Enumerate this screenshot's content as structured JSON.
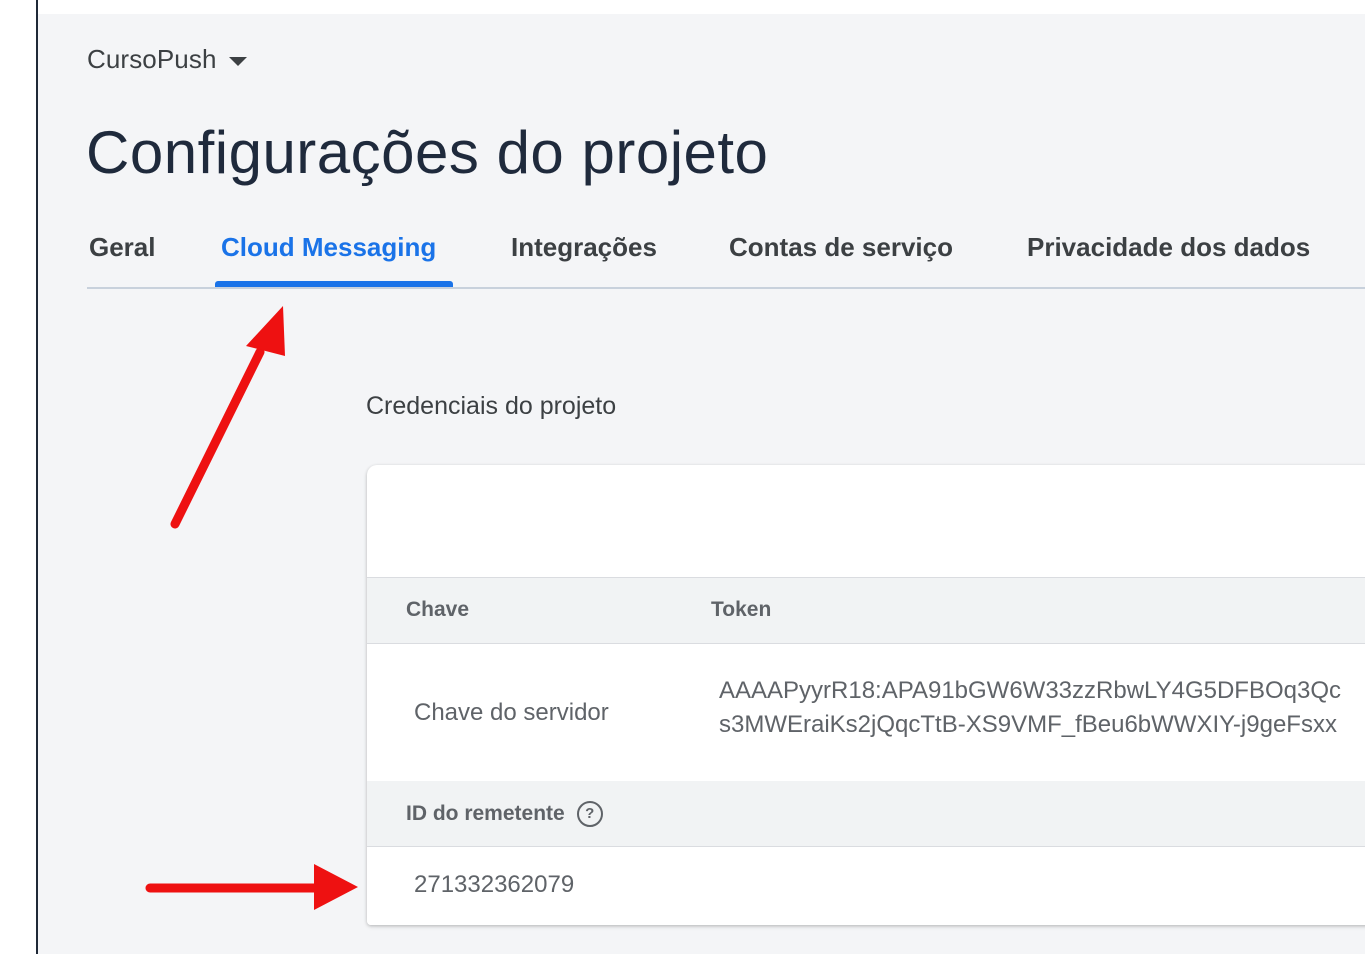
{
  "header": {
    "project_name": "CursoPush",
    "title": "Configurações do projeto"
  },
  "tabs": [
    {
      "label": "Geral",
      "active": false
    },
    {
      "label": "Cloud Messaging",
      "active": true
    },
    {
      "label": "Integrações",
      "active": false
    },
    {
      "label": "Contas de serviço",
      "active": false
    },
    {
      "label": "Privacidade dos dados",
      "active": false
    }
  ],
  "credentials": {
    "section_title": "Credenciais do projeto",
    "columns": {
      "key": "Chave",
      "token": "Token"
    },
    "server_key": {
      "label": "Chave do servidor",
      "token_line1": "AAAAPyyrR18:APA91bGW6W33zzRbwLY4G5DFBOq3Qc",
      "token_line2": "s3MWEraiKs2jQqcTtB-XS9VMF_fBeu6bWWXIY-j9geFsxx"
    },
    "sender_id": {
      "label": "ID do remetente",
      "value": "271332362079"
    }
  },
  "icons": {
    "project_dropdown": "caret-down-icon",
    "help": "help-circle-icon"
  },
  "colors": {
    "accent": "#1a73e8",
    "annotation_arrow": "#ee1111"
  }
}
